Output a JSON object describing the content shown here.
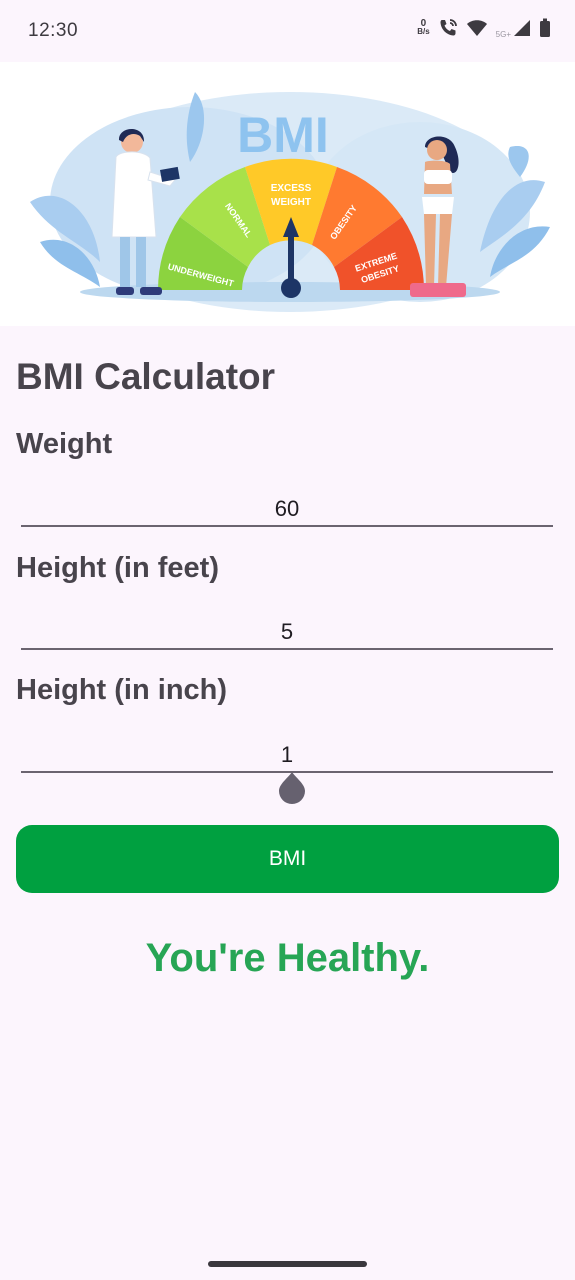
{
  "status_bar": {
    "time": "12:30",
    "net_speed_value": "0",
    "net_speed_unit": "B/s",
    "network_type": "5G+"
  },
  "banner": {
    "title": "BMI",
    "gauge_labels": {
      "underweight": "UNDERWEIGHT",
      "normal": "NORMAL",
      "excess_line1": "EXCESS",
      "excess_line2": "WEIGHT",
      "obesity": "OBESITY",
      "extreme_line1": "EXTREME",
      "extreme_line2": "OBESITY"
    }
  },
  "form": {
    "title": "BMI Calculator",
    "weight": {
      "label": "Weight",
      "value": "60"
    },
    "height_feet": {
      "label": "Height (in feet)",
      "value": "5"
    },
    "height_inch": {
      "label": "Height (in inch)",
      "value": "1"
    },
    "submit_label": "BMI"
  },
  "result": {
    "text": "You're Healthy."
  },
  "colors": {
    "button": "#00a040",
    "result": "#27a555",
    "background": "#fcf5fd"
  }
}
